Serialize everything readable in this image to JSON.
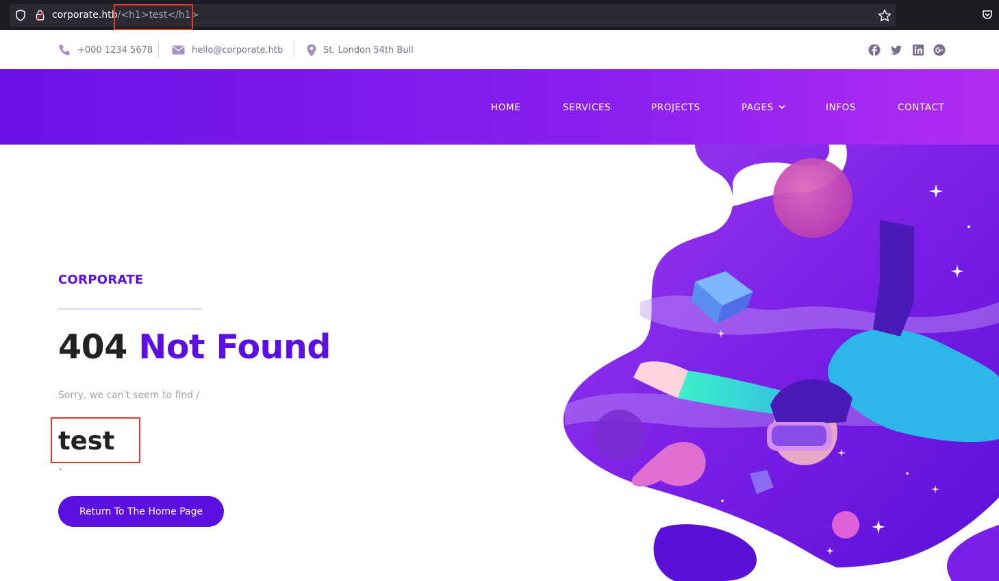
{
  "browser": {
    "url_host": "corporate.htb",
    "url_path": "/<h1>test</h1>",
    "icons": [
      "shield-icon",
      "lock-icon",
      "star-icon",
      "pocket-icon"
    ]
  },
  "topbar": {
    "phone": "+000 1234 5678",
    "email": "hello@corporate.htb",
    "address": "St. London 54th Bull",
    "socials": [
      "facebook-icon",
      "twitter-icon",
      "linkedin-icon",
      "google-plus-icon"
    ]
  },
  "nav": {
    "items": [
      "HOME",
      "SERVICES",
      "PROJECTS",
      "PAGES",
      "INFOS",
      "CONTACT"
    ]
  },
  "main": {
    "brand": "CORPORATE",
    "headline_number": "404",
    "headline_text": "Not Found",
    "sorry": "Sorry, we can't seem to find /",
    "injected": "test",
    "dot": ".",
    "button": "Return To The Home Page"
  },
  "colors": {
    "accent": "#5b0fe0",
    "nav_start": "#6a11e8",
    "nav_end": "#b22df2",
    "highlight": "#e03a2f"
  }
}
